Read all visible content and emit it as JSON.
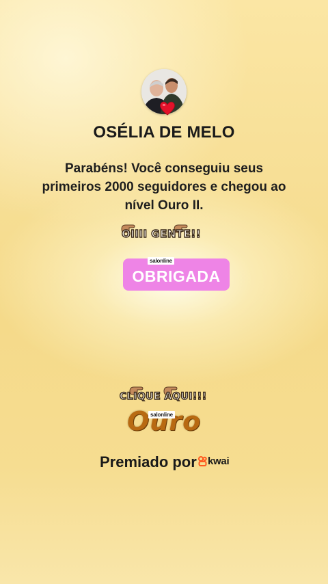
{
  "profile": {
    "name": "OSÉLIA DE MELO"
  },
  "message": "Parabéns! Você conseguiu seus primeiros 2000 seguidores e chegou ao nível Ouro II.",
  "stickers": {
    "greeting": "OIIII GENTE!!",
    "thanks_brand": "salonline",
    "thanks": "OBRIGADA",
    "cta": "CLIQUE AQUI!!!",
    "level_brand": "salonline",
    "level": "Ouro"
  },
  "footer": {
    "awarded_by": "Premiado por",
    "brand": "kwai"
  },
  "colors": {
    "background": "#f6dd91",
    "thanks_badge": "#ee84e6",
    "level_text": "#b86a12",
    "kwai_brand": "#ff5a1f"
  },
  "icons": {
    "heart": "red-heart-icon",
    "hands": "pointing-hand-icon",
    "kwai": "kwai-logo-icon"
  }
}
